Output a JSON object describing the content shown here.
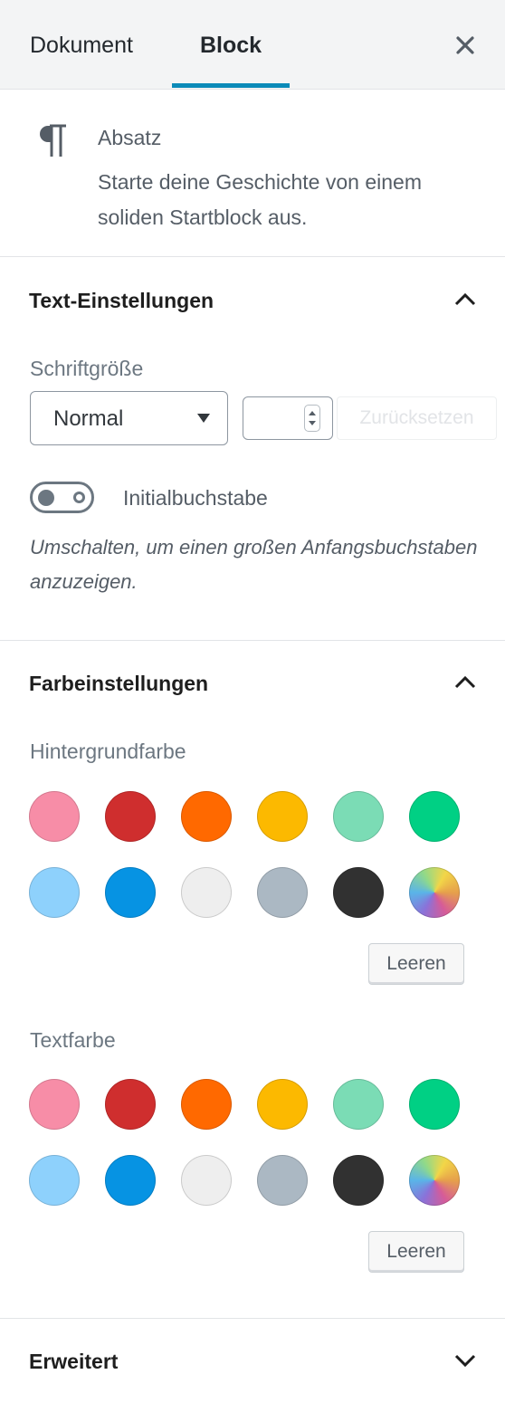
{
  "tabs": {
    "document": "Dokument",
    "block": "Block"
  },
  "block_card": {
    "title": "Absatz",
    "description": "Starte deine Geschichte von einem soliden Startblock aus."
  },
  "text_settings": {
    "title": "Text-Einstellungen",
    "font_size_label": "Schriftgröße",
    "font_size_value": "Normal",
    "custom_size_value": "",
    "reset_label": "Zurücksetzen",
    "dropcap_label": "Initialbuchstabe",
    "dropcap_enabled": false,
    "dropcap_help": "Umschalten, um einen großen Anfangsbuchstaben anzuzeigen."
  },
  "color_settings": {
    "title": "Farbeinstellungen",
    "background_label": "Hintergrundfarbe",
    "text_label": "Textfarbe",
    "clear_label": "Leeren",
    "palette": [
      "#f78da7",
      "#cf2e2e",
      "#ff6900",
      "#fcb900",
      "#7bdcb5",
      "#00d084",
      "#8ed1fc",
      "#0693e3",
      "#eeeeee",
      "#abb8c3",
      "#313131",
      "gradient"
    ]
  },
  "advanced": {
    "title": "Erweitert"
  }
}
